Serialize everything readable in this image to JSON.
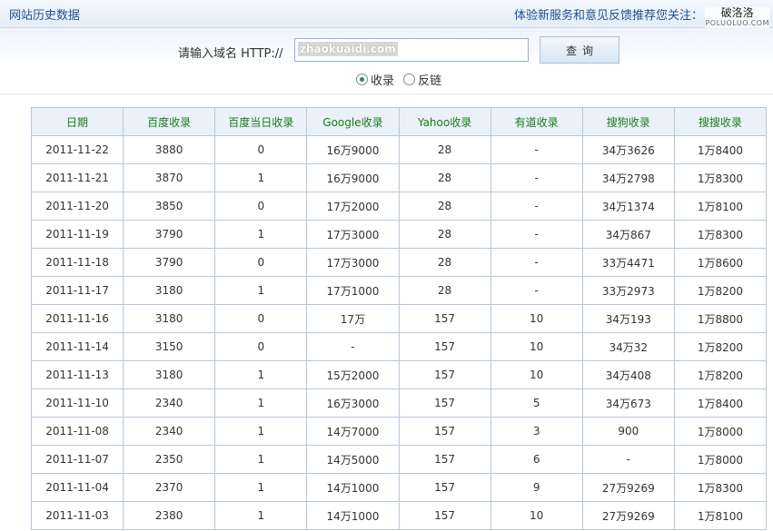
{
  "header": {
    "title": "网站历史数据",
    "promo": "体验新服务和意见反馈推荐您关注：",
    "watermark_main": "破洛洛",
    "watermark_sub": "POLUOLUO.COM"
  },
  "search": {
    "label": "请输入域名 HTTP://",
    "value": "zhaokuaidi.com",
    "button_label": "查询",
    "options": [
      {
        "label": "收录",
        "checked": true
      },
      {
        "label": "反链",
        "checked": false
      }
    ]
  },
  "table": {
    "columns": [
      "日期",
      "百度收录",
      "百度当日收录",
      "Google收录",
      "Yahoo收录",
      "有道收录",
      "搜狗收录",
      "搜搜收录"
    ],
    "rows": [
      [
        "2011-11-22",
        "3880",
        "0",
        "16万9000",
        "28",
        "-",
        "34万3626",
        "1万8400"
      ],
      [
        "2011-11-21",
        "3870",
        "1",
        "16万9000",
        "28",
        "-",
        "34万2798",
        "1万8300"
      ],
      [
        "2011-11-20",
        "3850",
        "0",
        "17万2000",
        "28",
        "-",
        "34万1374",
        "1万8100"
      ],
      [
        "2011-11-19",
        "3790",
        "1",
        "17万3000",
        "28",
        "-",
        "34万867",
        "1万8300"
      ],
      [
        "2011-11-18",
        "3790",
        "0",
        "17万3000",
        "28",
        "-",
        "33万4471",
        "1万8600"
      ],
      [
        "2011-11-17",
        "3180",
        "1",
        "17万1000",
        "28",
        "-",
        "33万2973",
        "1万8200"
      ],
      [
        "2011-11-16",
        "3180",
        "0",
        "17万",
        "157",
        "10",
        "34万193",
        "1万8800"
      ],
      [
        "2011-11-14",
        "3150",
        "0",
        "-",
        "157",
        "10",
        "34万32",
        "1万8200"
      ],
      [
        "2011-11-13",
        "3180",
        "1",
        "15万2000",
        "157",
        "10",
        "34万408",
        "1万8200"
      ],
      [
        "2011-11-10",
        "2340",
        "1",
        "16万3000",
        "157",
        "5",
        "34万673",
        "1万8400"
      ],
      [
        "2011-11-08",
        "2340",
        "1",
        "14万7000",
        "157",
        "3",
        "900",
        "1万8000"
      ],
      [
        "2011-11-07",
        "2350",
        "1",
        "14万5000",
        "157",
        "6",
        "-",
        "1万8000"
      ],
      [
        "2011-11-04",
        "2370",
        "1",
        "14万1000",
        "157",
        "9",
        "27万9269",
        "1万8300"
      ],
      [
        "2011-11-03",
        "2380",
        "1",
        "14万1000",
        "157",
        "10",
        "27万9269",
        "1万8100"
      ]
    ]
  }
}
